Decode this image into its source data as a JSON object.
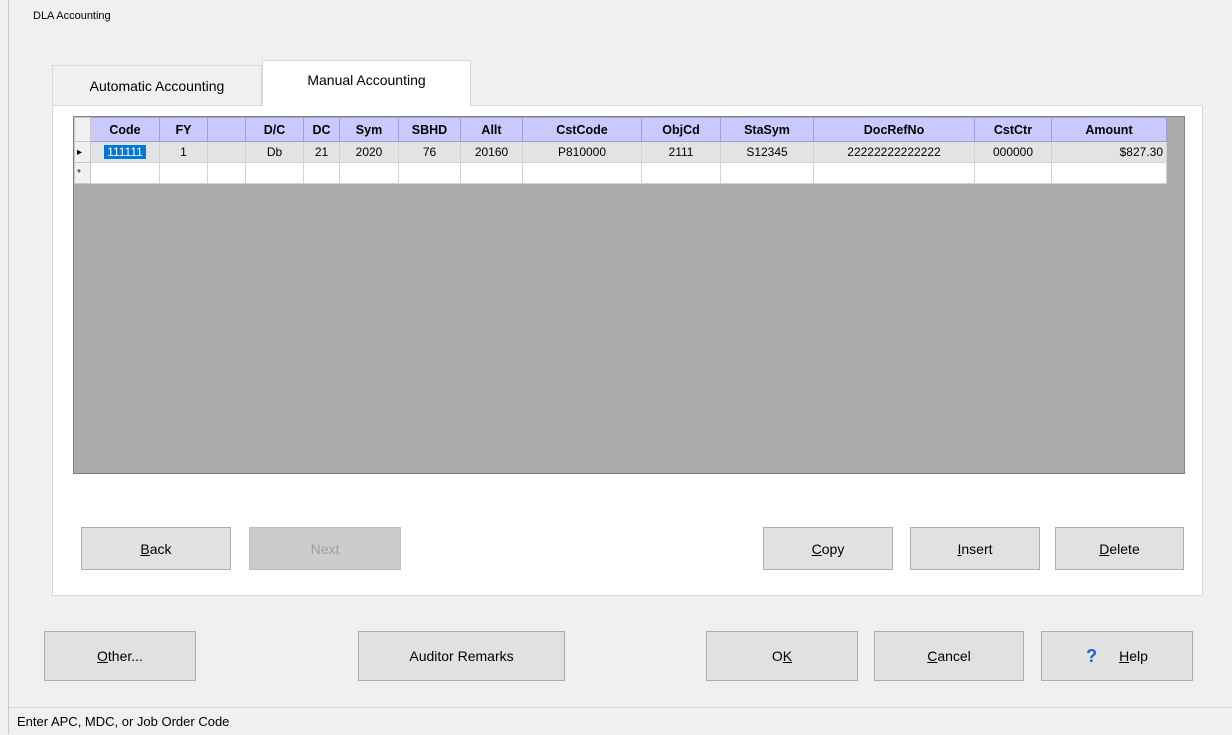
{
  "window": {
    "title": "DLA Accounting"
  },
  "tabs": [
    {
      "label": "Automatic Accounting",
      "active": false
    },
    {
      "label": "Manual Accounting",
      "active": true
    }
  ],
  "grid": {
    "columns": [
      "Code",
      "FY",
      "",
      "D/C",
      "DC",
      "Sym",
      "SBHD",
      "Allt",
      "CstCode",
      "ObjCd",
      "StaSym",
      "DocRefNo",
      "CstCtr",
      "Amount"
    ],
    "rows": [
      {
        "marker": "▸",
        "cells": [
          "111111",
          "1",
          "",
          "Db",
          "21",
          "2020",
          "76",
          "20160",
          "P810000",
          "2111",
          "S12345",
          "22222222222222",
          "000000",
          "$827.30"
        ]
      },
      {
        "marker": "*",
        "cells": [
          "",
          "",
          "",
          "",
          "",
          "",
          "",
          "",
          "",
          "",
          "",
          "",
          "",
          ""
        ]
      }
    ]
  },
  "panel_buttons": {
    "back": {
      "prefix": "",
      "underline": "B",
      "rest": "ack"
    },
    "next": {
      "label": "Next"
    },
    "copy": {
      "prefix": "",
      "underline": "C",
      "rest": "opy"
    },
    "insert": {
      "prefix": "",
      "underline": "I",
      "rest": "nsert"
    },
    "delete": {
      "prefix": "",
      "underline": "D",
      "rest": "elete"
    }
  },
  "bottom_buttons": {
    "other": {
      "underline": "O",
      "rest": "ther..."
    },
    "auditor_remarks": {
      "label": "Auditor Remarks"
    },
    "ok": {
      "prefix": "O",
      "underline": "K"
    },
    "cancel": {
      "underline": "C",
      "rest": "ancel"
    },
    "help": {
      "underline": "H",
      "rest": "elp",
      "icon": "?"
    }
  },
  "status": {
    "text": "Enter APC, MDC, or Job Order Code"
  }
}
